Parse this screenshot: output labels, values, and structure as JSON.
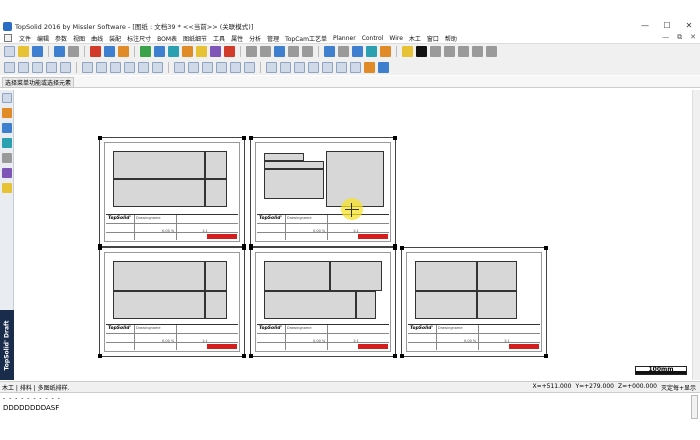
{
  "window": {
    "title": "TopSolid 2016 by Missler Software - [图纸 : 文档39 *  <<当前>> (关联模式)]",
    "controls": [
      "—",
      "☐",
      "✕"
    ]
  },
  "menubar": {
    "items": [
      "文件",
      "编辑",
      "参数",
      "视图",
      "曲线",
      "装配",
      "标注尺寸",
      "BOM表",
      "图纸细节",
      "工具",
      "属性",
      "分析",
      "管理",
      "TopCam工艺单",
      "Planner",
      "Control",
      "Wire",
      "木工",
      "窗口",
      "帮助"
    ],
    "mdi_controls": [
      "—",
      "⧉",
      "✕"
    ]
  },
  "hint": {
    "text": "选择菜单功能或选择元素"
  },
  "left_toolbar": {
    "brand": "TopSolid' Draft"
  },
  "sheets": [
    {
      "name_label": "Drawingname",
      "logo": "TopSolid'",
      "field1": "0.00 %",
      "field2": "1:1"
    },
    {
      "name_label": "Drawingname",
      "logo": "TopSolid'",
      "field1": "0.00 %",
      "field2": "1:1"
    },
    {
      "name_label": "Drawingname",
      "logo": "TopSolid'",
      "field1": "0.00 %",
      "field2": "1:1"
    },
    {
      "name_label": "Drawingname",
      "logo": "TopSolid'",
      "field1": "0.00 %",
      "field2": "1:1"
    },
    {
      "name_label": "Drawingname",
      "logo": "TopSolid'",
      "field1": "0.00 %",
      "field2": "1:1"
    }
  ],
  "scale_bar": {
    "label": "100mm"
  },
  "statusbar": {
    "left": "木工 | 排料 | 多图纸排样.",
    "x": "X=+511.000",
    "y": "Y=+279.000",
    "z": "Z=+000.000",
    "mode": "灭定每+显示"
  },
  "command": {
    "line1": "- - - - - - - - - -",
    "line2": "DDDDDDDDASF"
  }
}
